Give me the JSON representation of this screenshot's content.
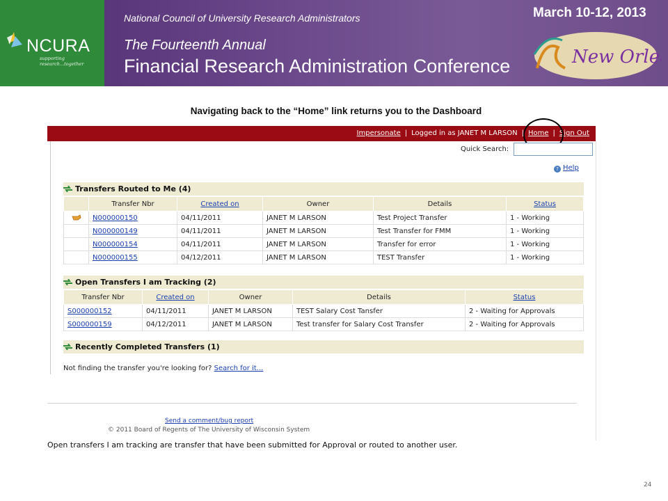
{
  "banner": {
    "logo_text": "NCURA",
    "logo_tagline": "supporting research...together",
    "organization": "National Council of University Research Administrators",
    "annual": "The Fourteenth Annual",
    "conference": "Financial Research Administration Conference",
    "date": "March 10-12, 2013",
    "city": "New Orleans"
  },
  "slide": {
    "heading": "Navigating back to the “Home” link returns you to the Dashboard",
    "caption": "Open transfers I am tracking are transfer that have been submitted for Approval or routed to another user.",
    "page_number": "24"
  },
  "appbar": {
    "impersonate": "Impersonate",
    "separator": "|",
    "logged_in": "Logged in as JANET M LARSON",
    "home": "Home",
    "sign_out": "Sign Out"
  },
  "quick_search": {
    "label": "Quick Search:",
    "value": ""
  },
  "help": {
    "label": "Help"
  },
  "routed": {
    "title": "Transfers Routed to Me (4)",
    "columns": [
      "Transfer Nbr",
      "Created on",
      "Owner",
      "Details",
      "Status"
    ],
    "rows": [
      {
        "nbr": "N000000150",
        "created": "04/11/2011",
        "owner": "JANET M LARSON",
        "details": "Test Project Transfer",
        "status": "1 - Working"
      },
      {
        "nbr": "N000000149",
        "created": "04/11/2011",
        "owner": "JANET M LARSON",
        "details": "Test Transfer for FMM",
        "status": "1 - Working"
      },
      {
        "nbr": "N000000154",
        "created": "04/11/2011",
        "owner": "JANET M LARSON",
        "details": "Transfer for error",
        "status": "1 - Working"
      },
      {
        "nbr": "N000000155",
        "created": "04/12/2011",
        "owner": "JANET M LARSON",
        "details": "TEST Transfer",
        "status": "1 - Working"
      }
    ]
  },
  "tracking": {
    "title": "Open Transfers I am Tracking (2)",
    "columns": [
      "Transfer Nbr",
      "Created on",
      "Owner",
      "Details",
      "Status"
    ],
    "rows": [
      {
        "nbr": "S000000152",
        "created": "04/11/2011",
        "owner": "JANET M LARSON",
        "details": "TEST Salary Cost Tansfer",
        "status": "2 - Waiting for Approvals"
      },
      {
        "nbr": "S000000159",
        "created": "04/12/2011",
        "owner": "JANET M LARSON",
        "details": "Test transfer for Salary Cost Transfer",
        "status": "2 - Waiting for Approvals"
      }
    ]
  },
  "completed": {
    "title": "Recently Completed Transfers (1)"
  },
  "not_finding": {
    "text": "Not finding the transfer you're looking for?",
    "link": "Search for it..."
  },
  "footer": {
    "link": "Send a comment/bug report",
    "copyright": "© 2011 Board of Regents of The University of Wisconsin System"
  },
  "colors": {
    "appbar": "#9b0b13",
    "banner": "#5e3a7e",
    "logo_green": "#2f8a3a",
    "section_bg": "#efebd3",
    "link": "#1a3fb0"
  }
}
